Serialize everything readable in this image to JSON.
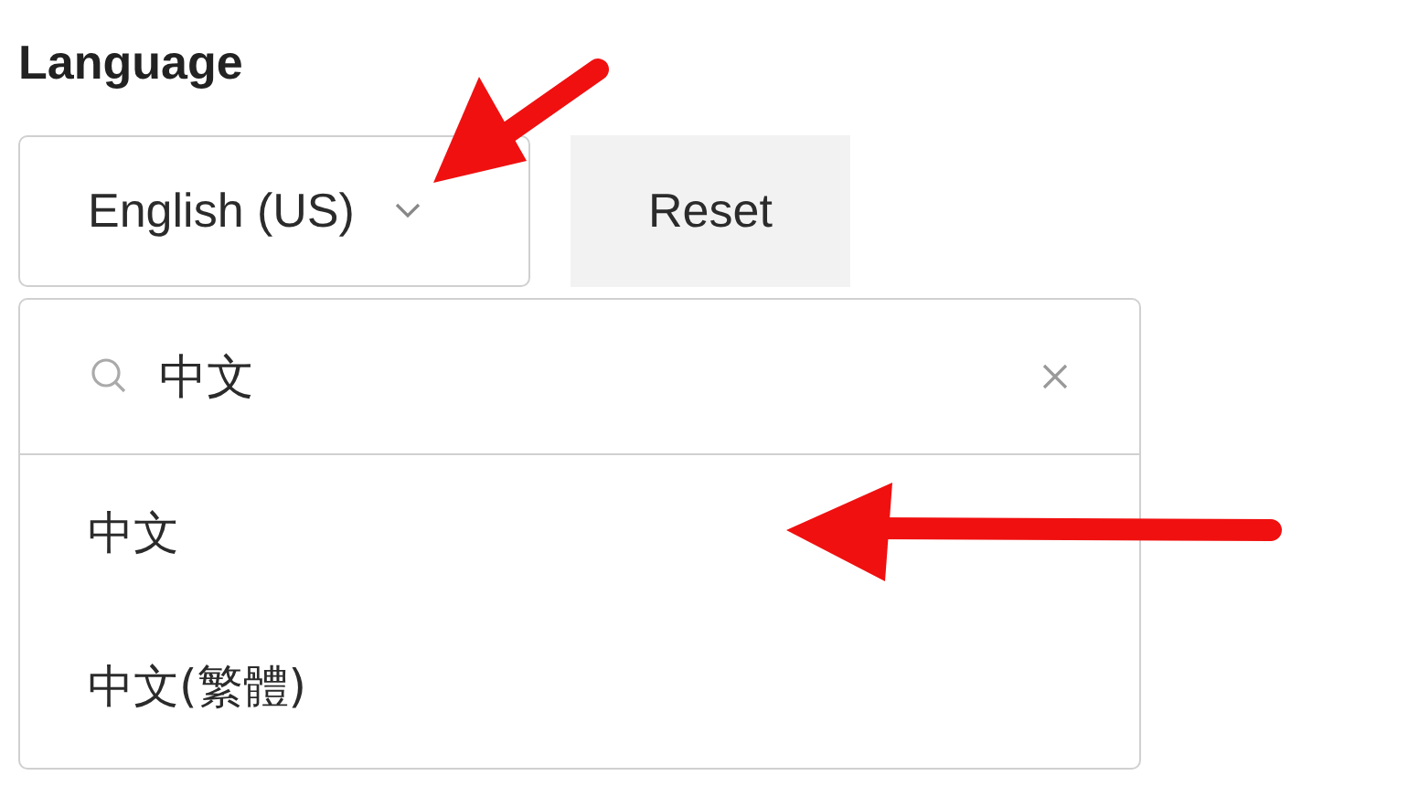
{
  "heading": "Language",
  "language_select": {
    "value": "English (US)"
  },
  "reset_button": "Reset",
  "dropdown": {
    "search": {
      "value": "中文"
    },
    "options": [
      {
        "label": "中文"
      },
      {
        "label": "中文(繁體)"
      }
    ]
  }
}
